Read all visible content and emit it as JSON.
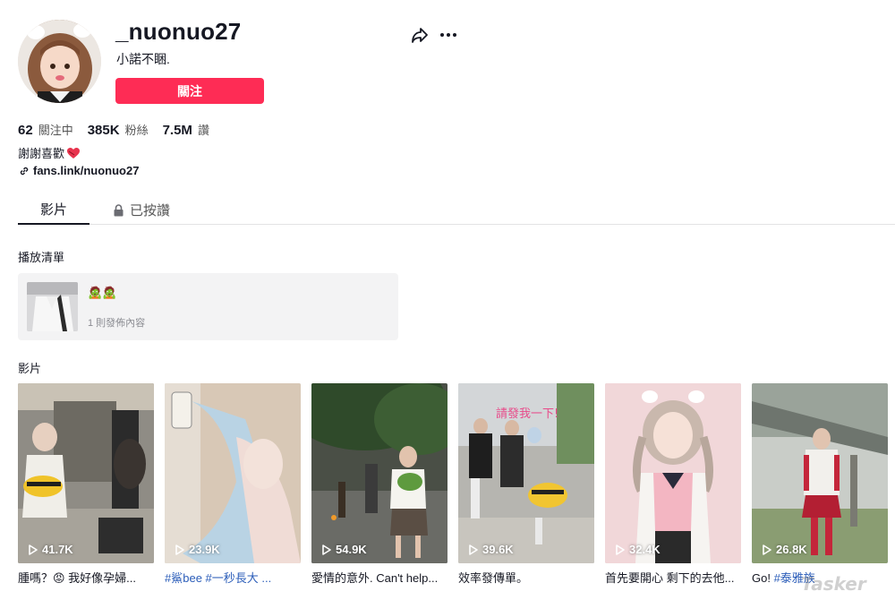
{
  "profile": {
    "username": "_nuonuo27",
    "nickname": "小諾不睏.",
    "follow_label": "關注"
  },
  "stats": [
    {
      "value": "62",
      "label": "關注中"
    },
    {
      "value": "385K",
      "label": "粉絲"
    },
    {
      "value": "7.5M",
      "label": "讚"
    }
  ],
  "bio": {
    "text": "謝謝喜歡"
  },
  "link": {
    "text": "fans.link/nuonuo27"
  },
  "tabs": {
    "videos": "影片",
    "liked": "已按讚"
  },
  "playlist": {
    "section_title": "播放清單",
    "name": "🧟🧟",
    "sub": "1 則發佈內容"
  },
  "videos": {
    "section_title": "影片",
    "items": [
      {
        "views": "41.7K",
        "caption": "腫嗎？😡 我好像孕婦..."
      },
      {
        "views": "23.9K",
        "caption_tags": "#鯊bee #一秒長大 ..."
      },
      {
        "views": "54.9K",
        "caption": "愛情的意外. Can't help..."
      },
      {
        "views": "39.6K",
        "caption": "效率發傳單。"
      },
      {
        "views": "32.4K",
        "caption": "首先要開心 剩下的去他..."
      },
      {
        "views": "26.8K",
        "caption_pre": "Go! ",
        "caption_tags": "#泰雅族"
      }
    ]
  },
  "watermark": "Tasker",
  "colors": {
    "accent": "#fe2c55",
    "text": "#161823",
    "tag": "#2b5db9",
    "card_bg": "#f3f3f4"
  }
}
